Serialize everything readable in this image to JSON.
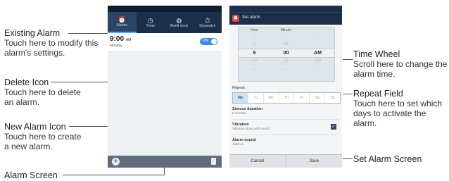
{
  "callouts": {
    "existing_alarm": {
      "title": "Existing Alarm",
      "desc": "Touch here to modify this alarm's settings."
    },
    "delete_icon": {
      "title": "Delete Icon",
      "desc": "Touch here to delete an alarm."
    },
    "new_alarm_icon": {
      "title": "New Alarm Icon",
      "desc": "Touch here to create a new alarm."
    },
    "alarm_screen": {
      "title": "Alarm Screen"
    },
    "time_wheel": {
      "title": "Time Wheel",
      "desc": "Scroll here to change the alarm time."
    },
    "repeat_field": {
      "title": "Repeat Field",
      "desc": "Touch here to set which days to activate the alarm."
    },
    "set_alarm_screen": {
      "title": "Set Alarm Screen"
    }
  },
  "phone1": {
    "tabs": [
      {
        "label": "Alarms",
        "icon": "alarm-clock-icon"
      },
      {
        "label": "Timer",
        "icon": "timer-icon"
      },
      {
        "label": "World clock",
        "icon": "globe-icon"
      },
      {
        "label": "Stopwatch",
        "icon": "stopwatch-icon"
      }
    ],
    "alarm": {
      "time": "9:00",
      "ampm": "AM",
      "day": "Monday",
      "toggle": "ON"
    }
  },
  "phone2": {
    "title": "Set alarm",
    "wheel": {
      "headers": [
        "Hour",
        "Minute",
        ""
      ],
      "rows": [
        [
          "8",
          "59",
          ""
        ],
        [
          "9",
          "00",
          "AM"
        ],
        [
          "10",
          "01",
          "PM"
        ]
      ]
    },
    "repeat_label": "Repeat",
    "days": [
      "Mo",
      "Tu",
      "We",
      "Th",
      "Fr",
      "Sa",
      "Su"
    ],
    "snooze": {
      "title": "Snooze duration",
      "sub": "5 minutes"
    },
    "vibration": {
      "title": "Vibration",
      "sub": "Vibration along with sound"
    },
    "alarm_sound": {
      "title": "Alarm sound",
      "sub": "Alarm 1"
    },
    "cancel": "Cancel",
    "save": "Save"
  }
}
